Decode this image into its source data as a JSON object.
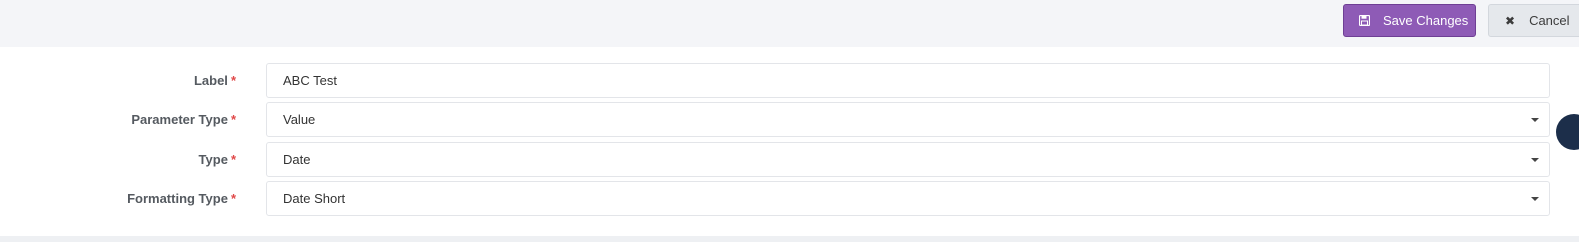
{
  "toolbar": {
    "save_label": "Save Changes",
    "cancel_label": "Cancel",
    "save_icon": "save-icon",
    "cancel_icon": "close-icon",
    "accent": "#8e5bb6"
  },
  "form": {
    "required_mark": "*",
    "fields": [
      {
        "label": "Label",
        "value": "ABC Test",
        "kind": "text"
      },
      {
        "label": "Parameter Type",
        "value": "Value",
        "kind": "select"
      },
      {
        "label": "Type",
        "value": "Date",
        "kind": "select"
      },
      {
        "label": "Formatting Type",
        "value": "Date Short",
        "kind": "select"
      }
    ]
  }
}
